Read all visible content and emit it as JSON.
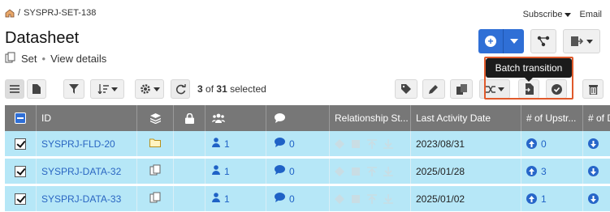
{
  "breadcrumb": {
    "separator": "/",
    "project": "SYSPRJ-SET-138"
  },
  "top_links": {
    "subscribe": "Subscribe",
    "email": "Email"
  },
  "page": {
    "title": "Datasheet",
    "type_label": "Set",
    "separator": "•",
    "view_details": "View details"
  },
  "tooltip": "Batch transition",
  "selection": {
    "count": "3",
    "of": "of",
    "total": "31",
    "suffix": "selected"
  },
  "table": {
    "headers": {
      "id": "ID",
      "relationship_status": "Relationship St...",
      "last_activity": "Last Activity Date",
      "upstream": "# of Upstr...",
      "downstream": "# of D"
    },
    "rows": [
      {
        "id": "SYSPRJ-FLD-20",
        "type_icon": "folder-icon",
        "users": "1",
        "comments": "0",
        "last_activity": "2023/08/31",
        "upstream": "0"
      },
      {
        "id": "SYSPRJ-DATA-32",
        "type_icon": "copy-icon",
        "users": "1",
        "comments": "0",
        "last_activity": "2025/01/28",
        "upstream": "3"
      },
      {
        "id": "SYSPRJ-DATA-33",
        "type_icon": "copy-icon",
        "users": "1",
        "comments": "0",
        "last_activity": "2025/01/02",
        "upstream": "1"
      }
    ]
  },
  "colors": {
    "accent": "#2f6fd6",
    "row_selected": "#b6e7f7",
    "header_bg": "#777777",
    "highlight_border": "#e05a2b"
  }
}
